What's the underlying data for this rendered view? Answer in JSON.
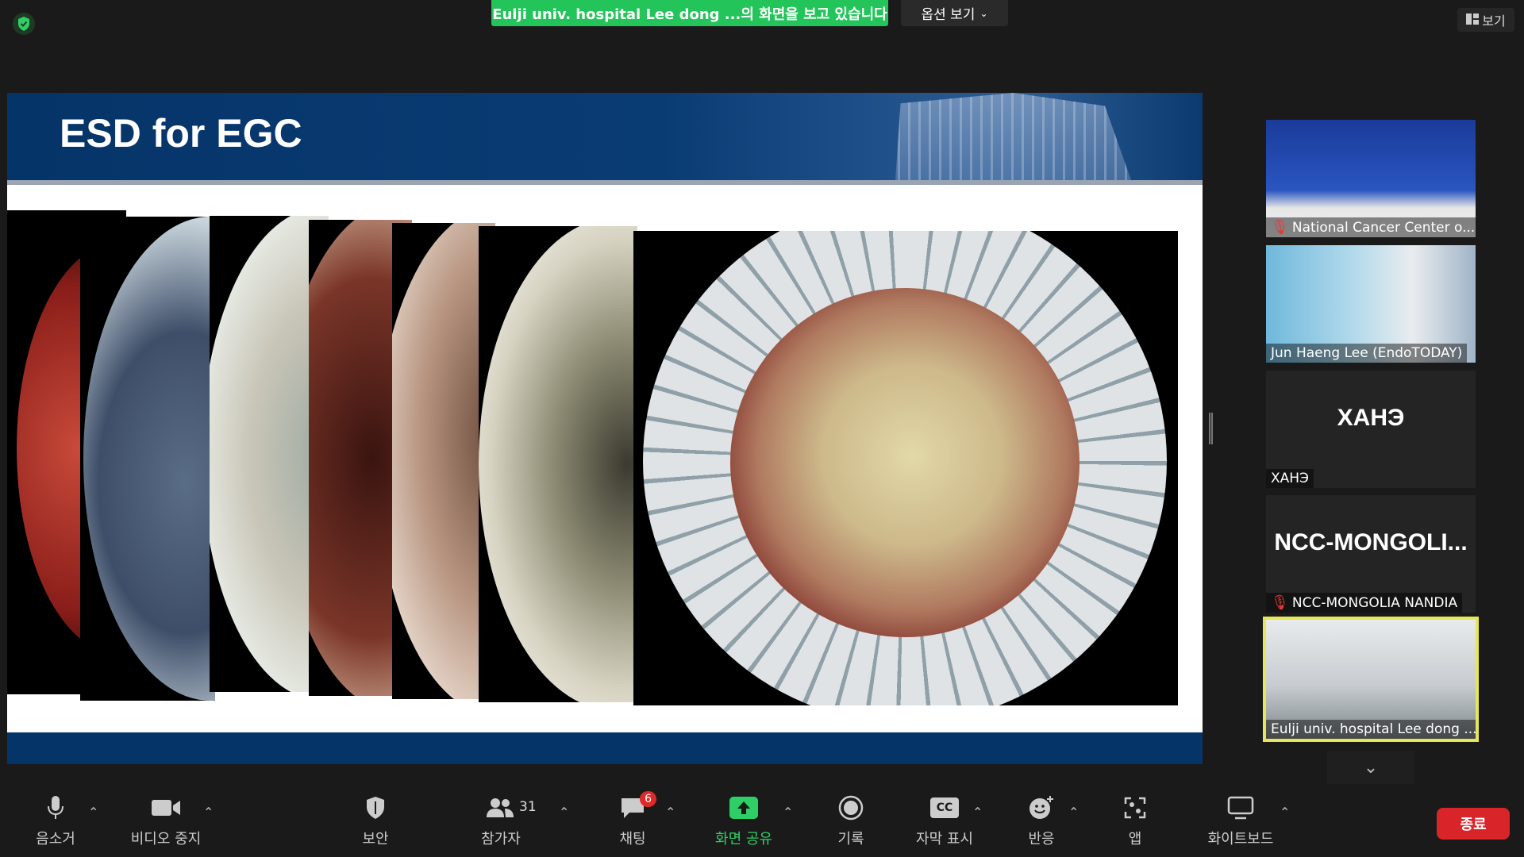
{
  "top": {
    "share_banner": "Eulji univ. hospital Lee dong ...의 화면을 보고 있습니다",
    "view_options": "옵션 보기",
    "view_button": "보기"
  },
  "slide": {
    "title": "ESD for EGC"
  },
  "participants": [
    {
      "name": "National Cancer Center o...",
      "muted": true,
      "video": true
    },
    {
      "name": "Jun Haeng Lee (EndoTODAY)",
      "muted": false,
      "video": true
    },
    {
      "name": "XAHЭ",
      "big_label": "XAHЭ",
      "muted": false,
      "video": false
    },
    {
      "name": "NCC-MONGOLIA NANDIA",
      "big_label": "NCC-MONGOLI...",
      "muted": true,
      "video": false
    },
    {
      "name": "Eulji univ. hospital Lee dong ...",
      "muted": false,
      "video": true,
      "active": true
    }
  ],
  "toolbar": {
    "mute": "음소거",
    "video_stop": "비디오 중지",
    "security": "보안",
    "participants": "참가자",
    "participant_count": "31",
    "chat": "채팅",
    "chat_badge": "6",
    "share_screen": "화면 공유",
    "record": "기록",
    "captions": "자막 표시",
    "captions_icon": "CC",
    "reactions": "반응",
    "apps": "앱",
    "whiteboard": "화이트보드",
    "end": "종료"
  },
  "colors": {
    "share_green": "#23c45a",
    "end_red": "#d9252a",
    "slide_blue": "#053468",
    "active_speaker": "#e6e65a"
  }
}
